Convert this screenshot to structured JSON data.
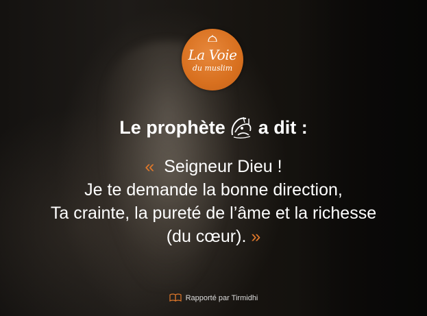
{
  "logo": {
    "title": "La Voie",
    "subtitle": "du muslim",
    "background_color": "#d8701f"
  },
  "heading": {
    "before": "Le prophète",
    "after": "a dit :",
    "seal_icon": "arabic-calligraphy-seal-icon"
  },
  "quote": {
    "open_mark": "«",
    "line1": "Seigneur Dieu !",
    "line2": "Je te demande la bonne direction,",
    "line3": "Ta crainte, la pureté de l’âme et la richesse",
    "line4": "(du cœur).",
    "close_mark": "»",
    "accent_color": "#e0782a"
  },
  "source": {
    "text": "Rapporté par Tirmidhi",
    "icon": "open-book-icon"
  }
}
